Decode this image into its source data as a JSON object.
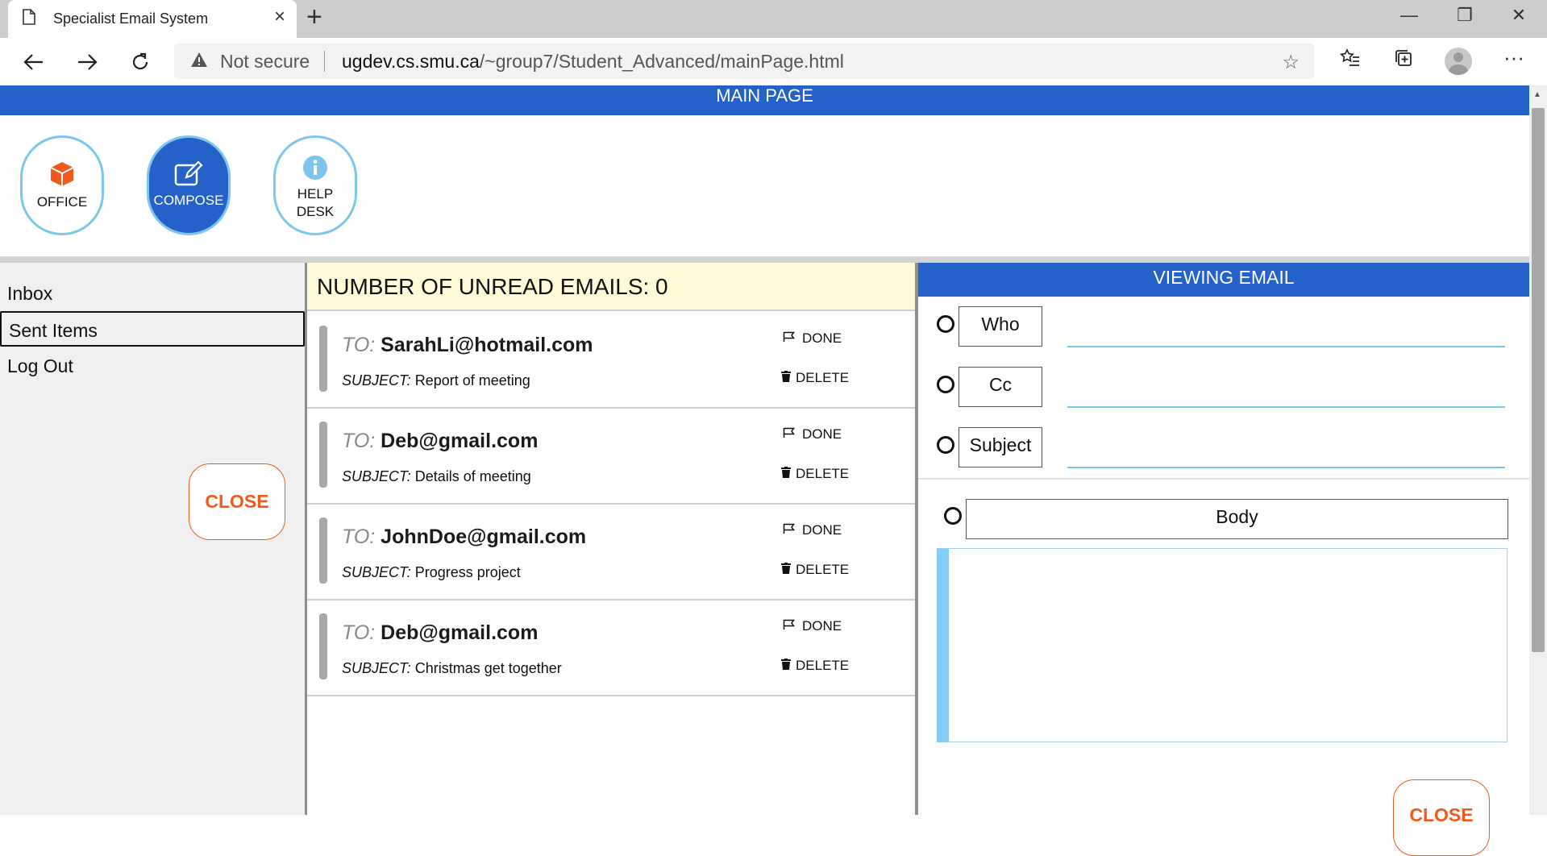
{
  "browser": {
    "tab_title": "Specialist Email System",
    "tab_close": "×",
    "new_tab": "+",
    "not_secure": "Not secure",
    "url_host": "ugdev.cs.smu.ca",
    "url_path": "/~group7/Student_Advanced/mainPage.html",
    "window": {
      "minimize": "—",
      "restore": "❐",
      "close": "✕"
    },
    "icons": [
      "page-icon",
      "back-icon",
      "forward-icon",
      "refresh-icon",
      "warning-icon",
      "star-icon",
      "favorites-icon",
      "collections-icon",
      "profile-avatar",
      "more-icon"
    ]
  },
  "page": {
    "banner": "MAIN PAGE",
    "buttons": {
      "office": "OFFICE",
      "compose": "COMPOSE",
      "help_line1": "HELP",
      "help_line2": "DESK"
    },
    "sidebar": {
      "items": [
        "Inbox",
        "Sent Items",
        "Log Out"
      ],
      "selected": "Sent Items",
      "close": "CLOSE"
    },
    "unread_label": "NUMBER OF UNREAD EMAILS: 0",
    "email_labels": {
      "to": "TO:",
      "subject": "SUBJECT:",
      "done": "DONE",
      "delete": "DELETE"
    },
    "emails": [
      {
        "to": "SarahLi@hotmail.com",
        "subject": "Report of meeting"
      },
      {
        "to": "Deb@gmail.com",
        "subject": "Details of meeting"
      },
      {
        "to": "JohnDoe@gmail.com",
        "subject": "Progress project"
      },
      {
        "to": "Deb@gmail.com",
        "subject": "Christmas get together"
      }
    ],
    "viewer": {
      "header": "VIEWING EMAIL",
      "fields": [
        "Who",
        "Cc",
        "Subject"
      ],
      "body_label": "Body",
      "body_value": "",
      "close": "CLOSE"
    }
  },
  "colors": {
    "accent_blue": "#2461c8",
    "light_blue": "#7fc6ee",
    "close_orange": "#f05a1c",
    "unread_bg": "#fffbd9",
    "office_icon": "#f05a1c"
  }
}
